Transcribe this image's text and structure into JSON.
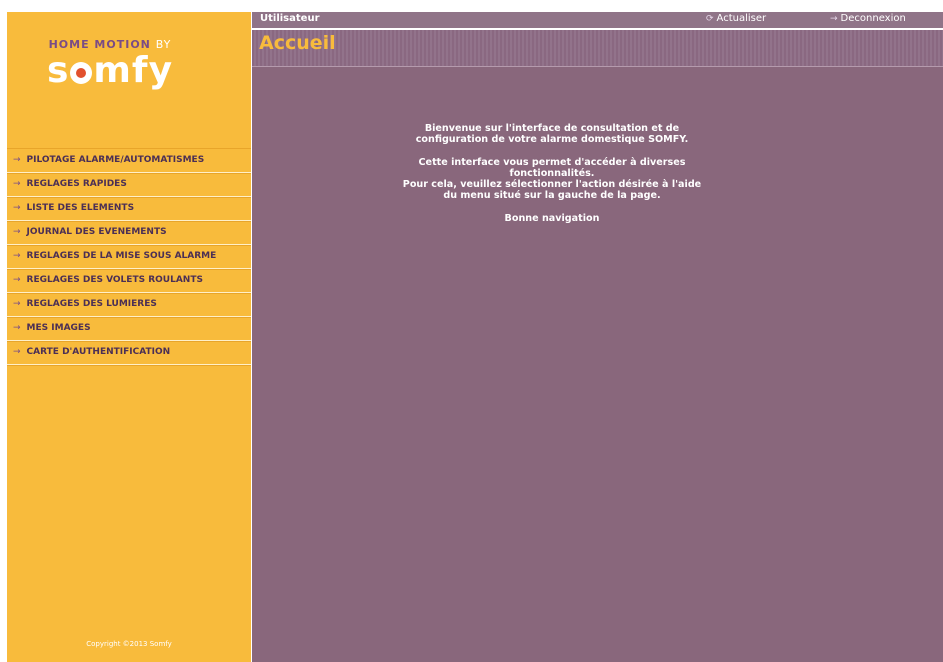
{
  "topbar": {
    "user_label": "Utilisateur",
    "refresh_label": "Actualiser",
    "logout_label": "Deconnexion"
  },
  "brand": {
    "line": "HOME MOTION",
    "by": "BY",
    "logo": "somfy"
  },
  "page": {
    "title": "Accueil"
  },
  "menu": {
    "items": [
      {
        "label": "PILOTAGE ALARME/AUTOMATISMES"
      },
      {
        "label": "REGLAGES RAPIDES"
      },
      {
        "label": "LISTE DES ELEMENTS"
      },
      {
        "label": "JOURNAL DES EVENEMENTS"
      },
      {
        "label": "REGLAGES DE LA MISE SOUS ALARME"
      },
      {
        "label": "REGLAGES DES VOLETS ROULANTS"
      },
      {
        "label": "REGLAGES DES LUMIERES"
      },
      {
        "label": "MES IMAGES"
      },
      {
        "label": "CARTE D'AUTHENTIFICATION"
      }
    ]
  },
  "welcome": {
    "p1": "Bienvenue sur l'interface de consultation et de\nconfiguration de votre alarme domestique SOMFY.",
    "p2": "Cette interface vous permet d'accéder à diverses\nfonctionnalités.\nPour cela, veuillez sélectionner l'action désirée à l'aide\ndu menu situé sur la gauche de la page.",
    "p3": "Bonne navigation"
  },
  "footer": {
    "copyright": "Copyright ©2013 Somfy"
  },
  "colors": {
    "sidebar": "#f8bb3c",
    "main": "#89677c",
    "title": "#f8bb3c",
    "topbar": "#907488"
  }
}
